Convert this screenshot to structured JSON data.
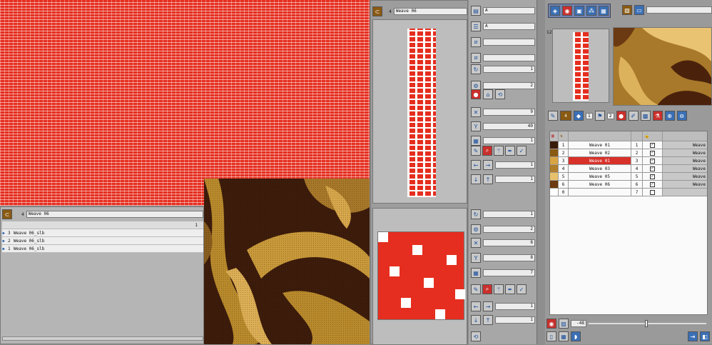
{
  "main_view": {
    "bottom_panel": {
      "header_num": "4",
      "header_name": "Weave 06",
      "col_header": "1",
      "items": [
        {
          "index": "3",
          "name": "Weave 06_slb"
        },
        {
          "index": "2",
          "name": "Weave 06_slb"
        },
        {
          "index": "1",
          "name": "Weave 06_slb"
        }
      ]
    }
  },
  "center_panel": {
    "header_num": "4",
    "header_name": "Weave 06",
    "fields_top": [
      "A",
      "A",
      "",
      ""
    ],
    "fields_mid": [
      "1",
      "2"
    ],
    "fields_xy": [
      "9",
      "40",
      "1"
    ],
    "fields_step": [
      "1",
      "1"
    ],
    "fields_bottom_top": [
      "1",
      "2"
    ],
    "fields_bottom_xy": [
      "8",
      "8",
      "7"
    ],
    "fields_bottom_step": [
      "1",
      "1"
    ]
  },
  "right_panel": {
    "preview_label": "12",
    "tab_count": "4",
    "toolbar_num1": "1",
    "toolbar_num2": "2",
    "table_rows": [
      {
        "num": "1",
        "name": "Weave 01",
        "idx": "1",
        "label": "Weave",
        "color": "#3a1d08"
      },
      {
        "num": "2",
        "name": "Weave 02",
        "idx": "2",
        "label": "Weave",
        "color": "#8a5a12"
      },
      {
        "num": "3",
        "name": "Weave 01",
        "idx": "3",
        "label": "Weave",
        "color": "#d9a441"
      },
      {
        "num": "4",
        "name": "Weave 03",
        "idx": "4",
        "label": "Weave",
        "color": "#b07d2a"
      },
      {
        "num": "5",
        "name": "Weave 05",
        "idx": "5",
        "label": "Weave",
        "color": "#e8c26b"
      },
      {
        "num": "6",
        "name": "Weave 06",
        "idx": "6",
        "label": "Weave",
        "color": "#6b3a12"
      },
      {
        "num": "0",
        "name": "",
        "idx": "7",
        "label": "",
        "color": "#ffffff"
      }
    ],
    "zoom_value": "-48"
  }
}
